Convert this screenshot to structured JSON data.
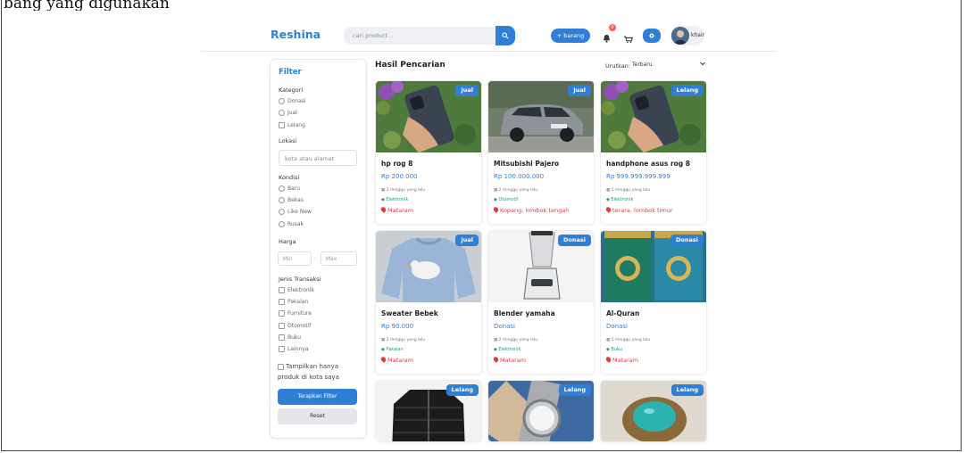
{
  "caption": "bang yang digunakan",
  "header": {
    "brand": "Reshina",
    "search_placeholder": "cari product...",
    "add_button": "+ barang",
    "notif_count": "0",
    "username": "khair"
  },
  "filter": {
    "title": "Filter",
    "kategori": {
      "label": "Kategori",
      "options": [
        "Donasi",
        "Jual",
        "Lelang"
      ]
    },
    "lokasi": {
      "label": "Lokasi",
      "placeholder": "kota atau alamat"
    },
    "kondisi": {
      "label": "Kondisi",
      "options": [
        "Baru",
        "Bekas",
        "Like New",
        "Rusak"
      ]
    },
    "harga": {
      "label": "Harga",
      "min": "Min",
      "max": "Max",
      "separator": "-"
    },
    "jenis": {
      "label": "Jenis Transaksi",
      "options": [
        "Elektronik",
        "Pakaian",
        "Furniture",
        "Otomotif",
        "Buku",
        "Lainnya"
      ]
    },
    "own_city": "Tampilkan hanya produk di kota saya",
    "apply": "Terapkan Filter",
    "reset": "Reset"
  },
  "results": {
    "title": "Hasil Pencarian",
    "sort_label": "Urutkan:",
    "sort_value": "Terbaru"
  },
  "products": [
    {
      "badge": "Jual",
      "name": "hp rog 8",
      "price": "Rp 200.000",
      "time": "2 minggu yang lalu",
      "category": "Elektronik",
      "location": "Mataram",
      "image": "phone"
    },
    {
      "badge": "Jual",
      "name": "Mitsubishi Pajero",
      "price": "Rp 100.000.000",
      "time": "2 minggu yang lalu",
      "category": "Otomotif",
      "location": "Kopang, lombok tengah",
      "image": "car"
    },
    {
      "badge": "Lelang",
      "name": "handphone asus rog 8",
      "price": "Rp 999.999.999.999",
      "time": "2 minggu yang lalu",
      "category": "Elektronik",
      "location": "terara, lombok timur",
      "image": "phone"
    },
    {
      "badge": "Jual",
      "name": "Sweater Bebek",
      "price": "Rp 90.000",
      "time": "2 minggu yang lalu",
      "category": "Pakaian",
      "location": "Mataram",
      "image": "sweater"
    },
    {
      "badge": "Donasi",
      "name": "Blender yamaha",
      "price": "Donasi",
      "time": "2 minggu yang lalu",
      "category": "Elektronik",
      "location": "Mataram",
      "image": "blender"
    },
    {
      "badge": "Donasi",
      "name": "Al-Quran",
      "price": "Donasi",
      "time": "2 minggu yang lalu",
      "category": "Buku",
      "location": "Mataram",
      "image": "quran"
    },
    {
      "badge": "Lelang",
      "name": "",
      "price": "",
      "time": "",
      "category": "",
      "location": "",
      "image": "jacket"
    },
    {
      "badge": "Lelang",
      "name": "",
      "price": "",
      "time": "",
      "category": "",
      "location": "",
      "image": "watch"
    },
    {
      "badge": "Lelang",
      "name": "",
      "price": "",
      "time": "",
      "category": "",
      "location": "",
      "image": "ring"
    }
  ],
  "colors": {
    "accent": "#2f7fd6",
    "category_green": "#22a06b",
    "location_red": "#e23b3b",
    "notif_red": "#ff5a5a"
  }
}
